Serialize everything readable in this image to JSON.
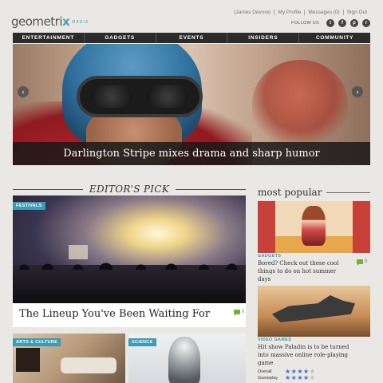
{
  "brand": {
    "name_main": "geometri",
    "name_accent": "x",
    "sub": "MEDIA"
  },
  "user_links": [
    "(James Devore)",
    "My Profile",
    "Messages (0)",
    "Sign Out"
  ],
  "follow": {
    "label": "FOLLOW US",
    "icons": [
      "twitter-icon",
      "facebook-icon",
      "pinterest-icon",
      "rss-icon"
    ],
    "glyphs": [
      "t",
      "f",
      "p",
      "r"
    ]
  },
  "nav": [
    "ENTERTAINMENT",
    "GADGETS",
    "EVENTS",
    "INSIDERS",
    "COMMUNITY"
  ],
  "hero": {
    "caption": "Darlington Stripe mixes drama and sharp humor",
    "prev": "‹",
    "next": "›"
  },
  "editors_pick": {
    "heading": "EDITOR'S PICK",
    "feature": {
      "tag": "FESTIVALS",
      "title": "The Lineup You've Been Waiting For",
      "comments": "0"
    },
    "thumbs": [
      {
        "tag": "ARTS & CULTURE"
      },
      {
        "tag": "SCIENCE"
      }
    ]
  },
  "most_popular": {
    "heading": "most popular",
    "items": [
      {
        "category": "GADGETS",
        "text": "Bored? Check out these cool things to do on hot summer days",
        "comments": "0"
      },
      {
        "category": "VIDEO GAMES",
        "text": "Hit show Paladin is to be turned into massive online role-playing game"
      }
    ],
    "ratings": [
      {
        "label": "Overall",
        "score": 4,
        "max": 5
      },
      {
        "label": "Gameplay",
        "score": 4,
        "max": 5
      }
    ]
  },
  "colors": {
    "accent": "#3d9bb4",
    "nav_bg": "#2b2b2b",
    "star": "#3d6fd0",
    "comment": "#6bb33a"
  }
}
